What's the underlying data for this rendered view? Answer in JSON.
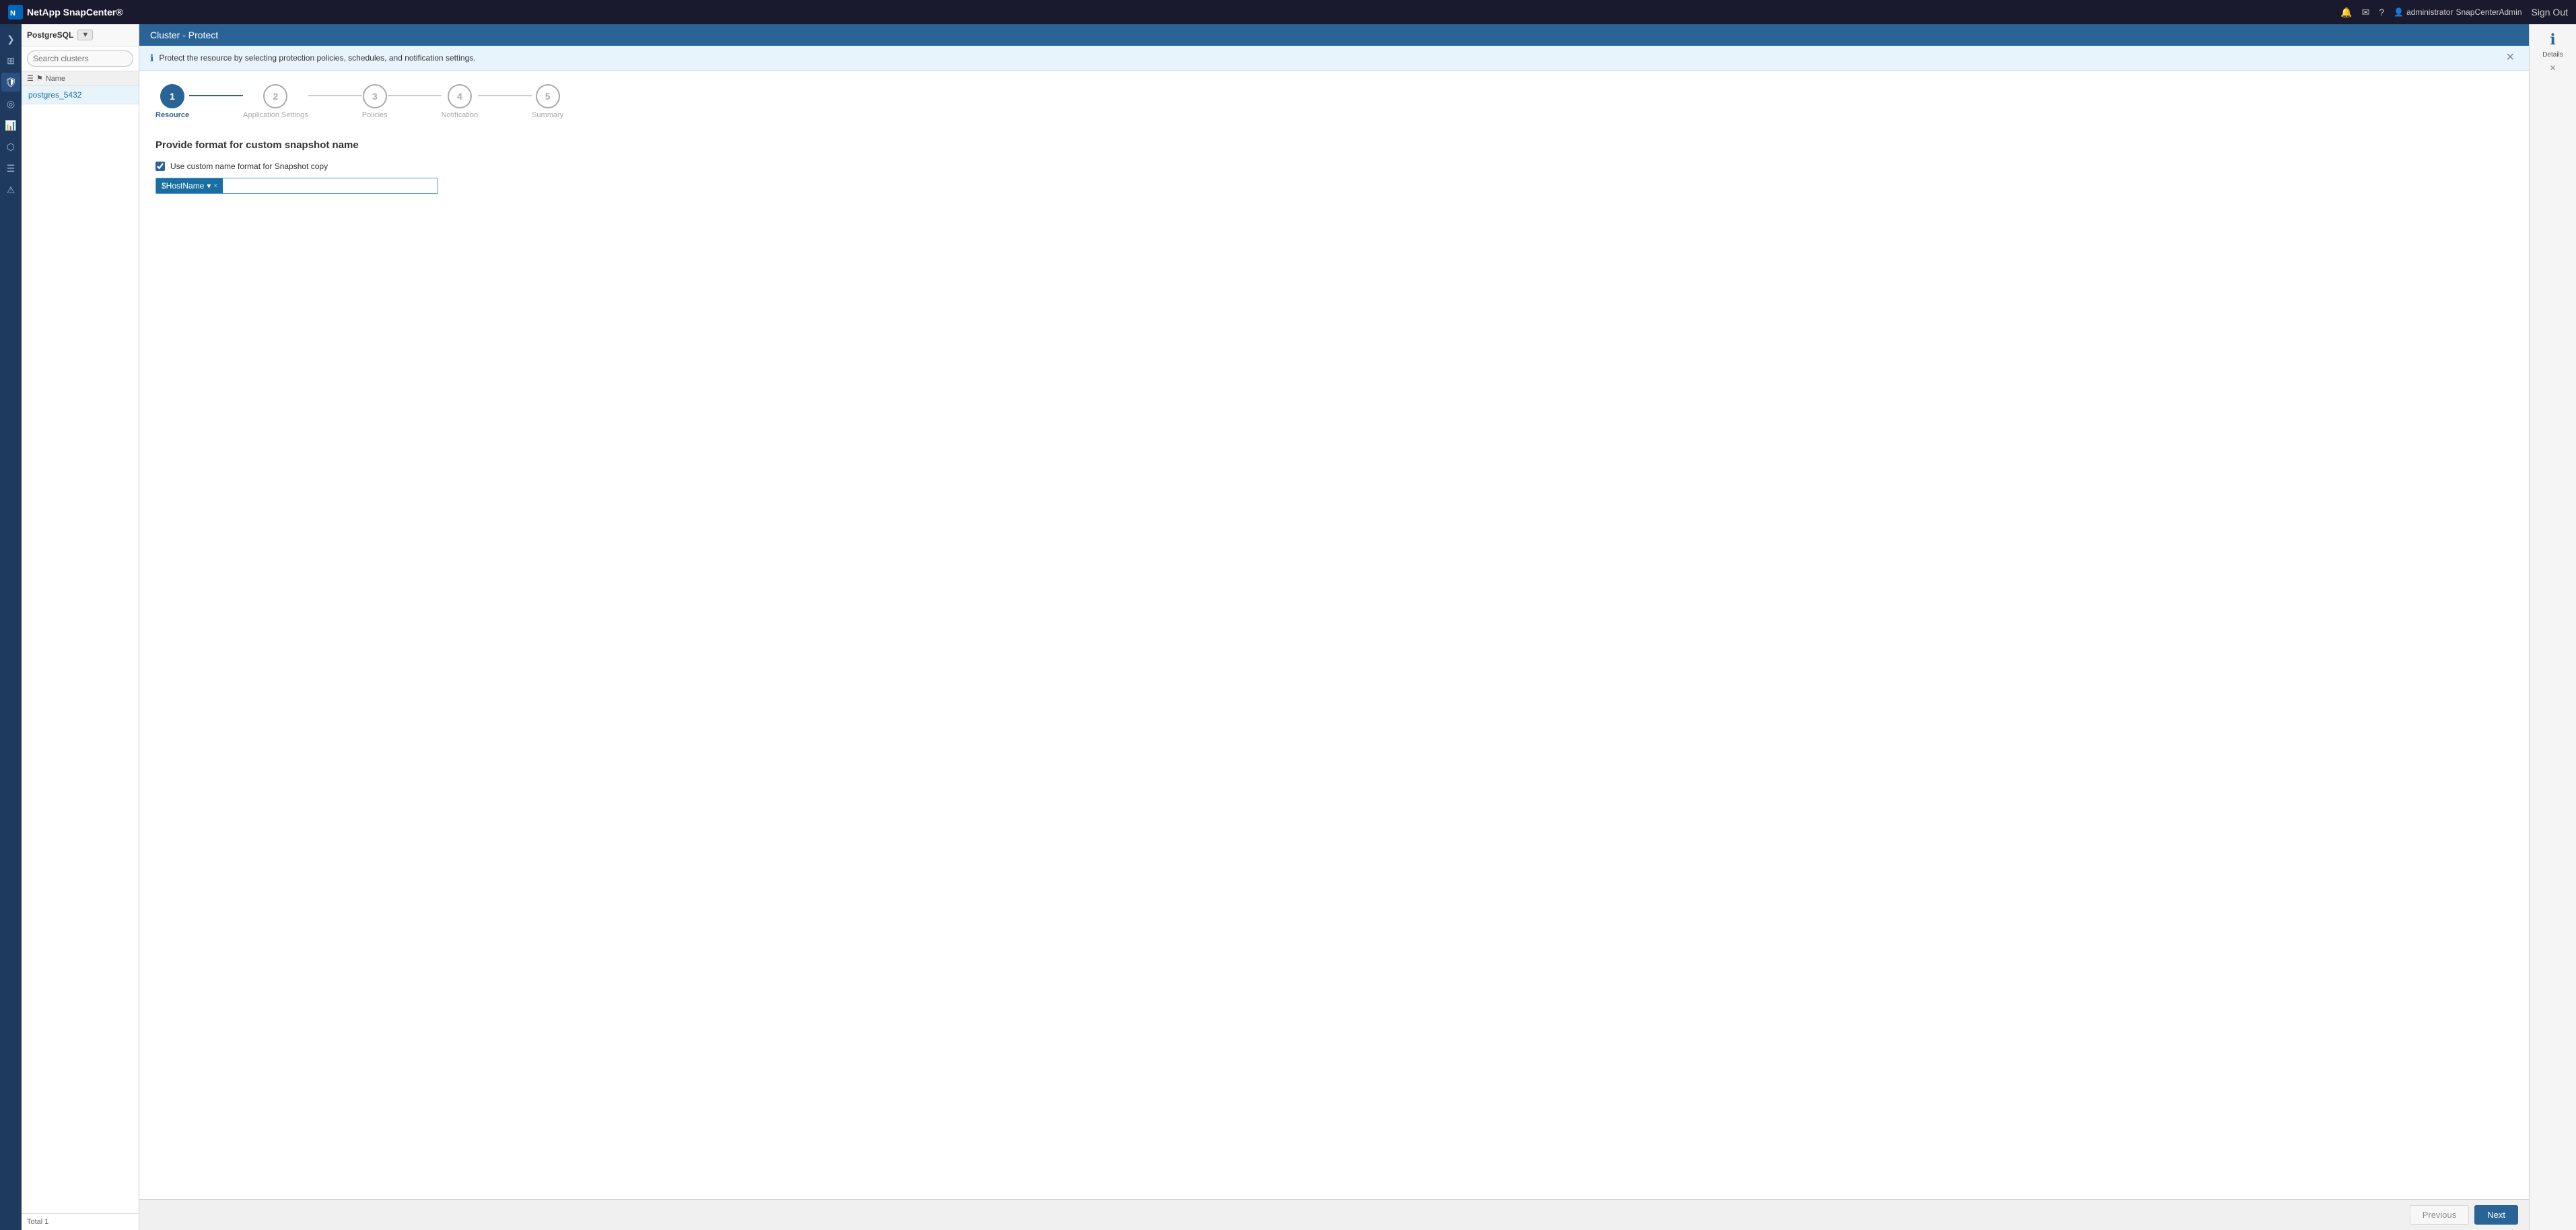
{
  "app": {
    "name": "NetApp",
    "product": "SnapCenter®",
    "logo_text": "NetApp SnapCenter®"
  },
  "topnav": {
    "bell_icon": "🔔",
    "mail_icon": "✉",
    "help_icon": "?",
    "user_icon": "👤",
    "username": "administrator",
    "tenant": "SnapCenterAdmin",
    "signout": "Sign Out"
  },
  "sidebar": {
    "items": [
      {
        "id": "nav-home",
        "icon": "❯",
        "label": "Expand"
      },
      {
        "id": "nav-apps",
        "icon": "⊞",
        "label": "Apps"
      },
      {
        "id": "nav-shield",
        "icon": "🛡",
        "label": "Protection",
        "active": true
      },
      {
        "id": "nav-globe",
        "icon": "◎",
        "label": "Topology"
      },
      {
        "id": "nav-chart",
        "icon": "📊",
        "label": "Reports"
      },
      {
        "id": "nav-nodes",
        "icon": "⬡",
        "label": "Hosts"
      },
      {
        "id": "nav-list",
        "icon": "☰",
        "label": "Settings"
      },
      {
        "id": "nav-alert",
        "icon": "⚠",
        "label": "Alerts"
      }
    ]
  },
  "left_panel": {
    "db_label": "PostgreSQL",
    "dropdown_label": "▼",
    "search_placeholder": "Search clusters",
    "columns": [
      {
        "id": "col-list",
        "icon": "☰"
      },
      {
        "id": "col-flag",
        "icon": "⚑"
      },
      {
        "id": "col-name",
        "label": "Name"
      }
    ],
    "clusters": [
      {
        "name": "postgres_5432"
      }
    ],
    "footer": "Total 1"
  },
  "page_header": {
    "title": "Cluster - Protect"
  },
  "info_banner": {
    "message": "Protect the resource by selecting protection policies, schedules, and notification settings."
  },
  "wizard": {
    "steps": [
      {
        "number": "1",
        "label": "Resource",
        "state": "active"
      },
      {
        "number": "2",
        "label": "Application Settings",
        "state": "upcoming"
      },
      {
        "number": "3",
        "label": "Policies",
        "state": "upcoming"
      },
      {
        "number": "4",
        "label": "Notification",
        "state": "upcoming"
      },
      {
        "number": "5",
        "label": "Summary",
        "state": "upcoming"
      }
    ],
    "connectors": [
      {
        "state": "active"
      },
      {
        "state": "inactive"
      },
      {
        "state": "inactive"
      },
      {
        "state": "inactive"
      }
    ]
  },
  "form": {
    "section_title": "Provide format for custom snapshot name",
    "checkbox_label": "Use custom name format for Snapshot copy",
    "checkbox_checked": true,
    "snapshot_tag": "$HostName ▾",
    "snapshot_tag_text": "$HostName",
    "snapshot_tag_close": "×",
    "snapshot_input_placeholder": ""
  },
  "footer": {
    "previous_label": "Previous",
    "next_label": "Next"
  },
  "details_panel": {
    "icon": "ℹ",
    "label": "Details"
  }
}
